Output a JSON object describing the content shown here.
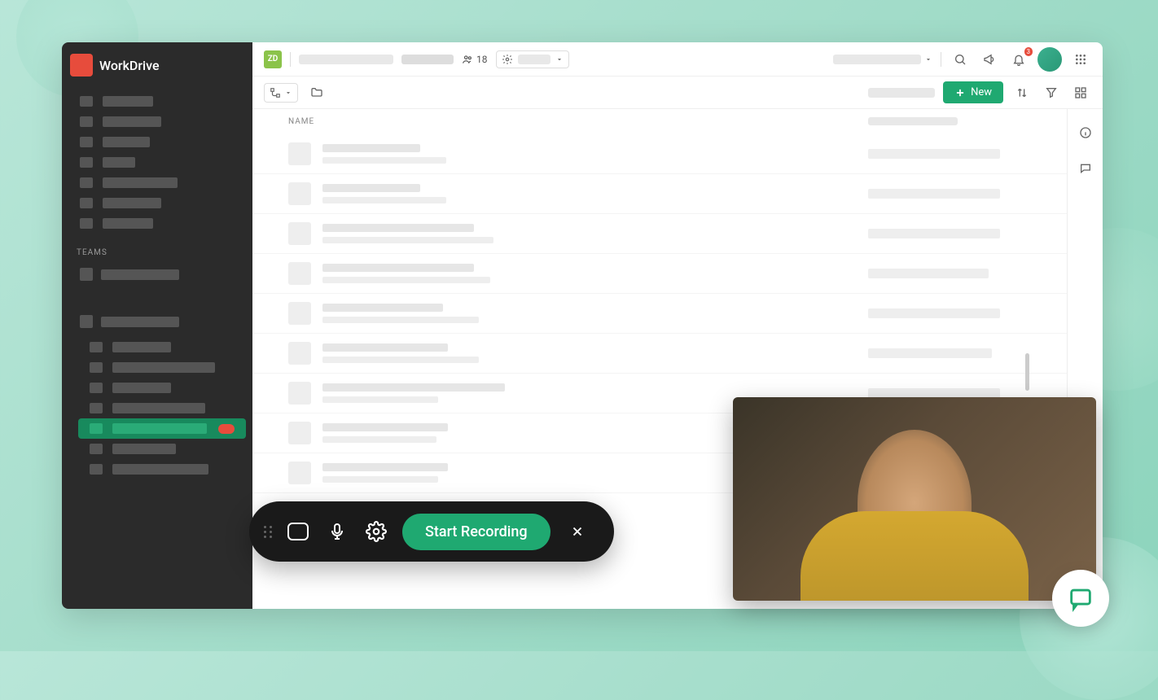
{
  "brand": "WorkDrive",
  "sidebar": {
    "teams_label": "TEAMS"
  },
  "topbar": {
    "zd_label": "ZD",
    "people_count": "18",
    "notification_count": "3"
  },
  "toolbar": {
    "new_label": "New"
  },
  "list": {
    "name_header": "NAME"
  },
  "recorder": {
    "start_label": "Start Recording"
  },
  "colors": {
    "accent": "#1fa971",
    "brand_red": "#e74c3c"
  }
}
